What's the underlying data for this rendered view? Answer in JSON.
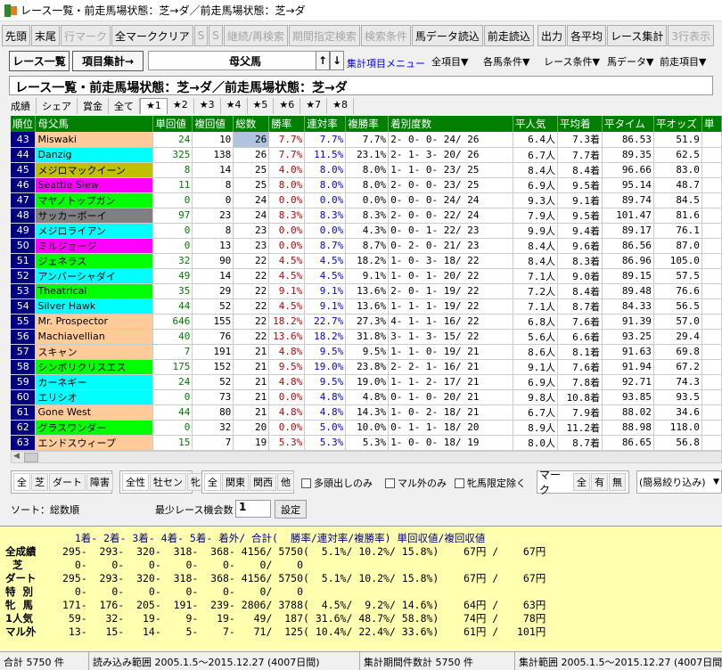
{
  "window": {
    "title": "レース一覧・前走馬場状態：芝→ダ／前走馬場状態：芝→ダ",
    "icon": "app-icon"
  },
  "toolbar": [
    {
      "label": "先頭",
      "enabled": true
    },
    {
      "label": "末尾",
      "enabled": true
    },
    {
      "label": "行マーク",
      "enabled": false
    },
    {
      "label": "全マーククリア",
      "enabled": true
    },
    {
      "label": "S",
      "enabled": false
    },
    {
      "label": "S",
      "enabled": false
    },
    {
      "label": "継続/再検索",
      "enabled": false
    },
    {
      "label": "期間指定検索",
      "enabled": false
    },
    {
      "label": "検索条件",
      "enabled": false
    },
    {
      "label": "馬データ読込",
      "enabled": true
    },
    {
      "label": "前走読込",
      "enabled": true
    },
    {
      "label": "出力",
      "enabled": true
    },
    {
      "label": "各平均",
      "enabled": true
    },
    {
      "label": "レース集計",
      "enabled": true
    },
    {
      "label": "3行表示",
      "enabled": false
    }
  ],
  "view": {
    "race_list": "レース一覧",
    "item_stats": "項目集計→",
    "combo_value": "母父馬",
    "up": "↑",
    "down": "↓",
    "menu_link": "集計項目メニュー"
  },
  "menus": [
    "全項目▼",
    "各馬条件▼",
    "レース条件▼",
    "馬データ▼",
    "前走項目▼"
  ],
  "condition_text": "レース一覧・前走馬場状態：芝→ダ／前走馬場状態：芝→ダ",
  "tabs": [
    "成績",
    "シェア",
    "賞金",
    "全て",
    "★1",
    "★2",
    "★3",
    "★4",
    "★5",
    "★6",
    "★7",
    "★8"
  ],
  "selected_tab": "★1",
  "table": {
    "headers": [
      "順位",
      "母父馬",
      "単回値",
      "複回値",
      "総数",
      "勝率",
      "連対率",
      "複勝率",
      "着別度数",
      "平人気",
      "平均着",
      "平タイム",
      "平オッズ",
      "単"
    ],
    "rows": [
      {
        "rank": "43",
        "name": "Miswaki",
        "color": "#ffcc99",
        "tan": "24",
        "fuku": "10",
        "n": "26",
        "w": "7.7%",
        "r": "7.7%",
        "f": "7.7%",
        "dist": "2-  0-  0- 24/ 26",
        "pop": "6.4人",
        "avg": "7.3着",
        "time": "86.53",
        "odds": "51.9"
      },
      {
        "rank": "44",
        "name": "Danzig",
        "color": "#00ffff",
        "tan": "325",
        "fuku": "138",
        "n": "26",
        "w": "7.7%",
        "r": "11.5%",
        "f": "23.1%",
        "dist": "2-  1-  3- 20/ 26",
        "pop": "6.7人",
        "avg": "7.7着",
        "time": "89.35",
        "odds": "62.5"
      },
      {
        "rank": "45",
        "name": "メジロマックイーン",
        "color": "#c0c000",
        "tan": "8",
        "fuku": "14",
        "n": "25",
        "w": "4.0%",
        "r": "8.0%",
        "f": "8.0%",
        "dist": "1-  1-  0- 23/ 25",
        "pop": "8.4人",
        "avg": "8.4着",
        "time": "96.66",
        "odds": "83.0"
      },
      {
        "rank": "46",
        "name": "Seattle Slew",
        "color": "#ff00ff",
        "tan": "11",
        "fuku": "8",
        "n": "25",
        "w": "8.0%",
        "r": "8.0%",
        "f": "8.0%",
        "dist": "2-  0-  0- 23/ 25",
        "pop": "6.9人",
        "avg": "9.5着",
        "time": "95.14",
        "odds": "48.7"
      },
      {
        "rank": "47",
        "name": "マヤノトップガン",
        "color": "#00ff00",
        "tan": "0",
        "fuku": "0",
        "n": "24",
        "w": "0.0%",
        "r": "0.0%",
        "f": "0.0%",
        "dist": "0-  0-  0- 24/ 24",
        "pop": "9.3人",
        "avg": "9.1着",
        "time": "89.74",
        "odds": "84.5"
      },
      {
        "rank": "48",
        "name": "サッカーボーイ",
        "color": "#808080",
        "tan": "97",
        "fuku": "23",
        "n": "24",
        "w": "8.3%",
        "r": "8.3%",
        "f": "8.3%",
        "dist": "2-  0-  0- 22/ 24",
        "pop": "7.9人",
        "avg": "9.5着",
        "time": "101.47",
        "odds": "81.6"
      },
      {
        "rank": "49",
        "name": "メジロライアン",
        "color": "#00ffff",
        "tan": "0",
        "fuku": "8",
        "n": "23",
        "w": "0.0%",
        "r": "0.0%",
        "f": "4.3%",
        "dist": "0-  0-  1- 22/ 23",
        "pop": "9.9人",
        "avg": "9.4着",
        "time": "89.17",
        "odds": "76.1"
      },
      {
        "rank": "50",
        "name": "ミルジョージ",
        "color": "#ff00ff",
        "tan": "0",
        "fuku": "13",
        "n": "23",
        "w": "0.0%",
        "r": "8.7%",
        "f": "8.7%",
        "dist": "0-  2-  0- 21/ 23",
        "pop": "8.4人",
        "avg": "9.6着",
        "time": "86.56",
        "odds": "87.0"
      },
      {
        "rank": "51",
        "name": "ジェネラス",
        "color": "#00ff00",
        "tan": "32",
        "fuku": "90",
        "n": "22",
        "w": "4.5%",
        "r": "4.5%",
        "f": "18.2%",
        "dist": "1-  0-  3- 18/ 22",
        "pop": "8.4人",
        "avg": "8.3着",
        "time": "86.96",
        "odds": "105.0"
      },
      {
        "rank": "52",
        "name": "アンバーシャダイ",
        "color": "#00ffff",
        "tan": "49",
        "fuku": "14",
        "n": "22",
        "w": "4.5%",
        "r": "4.5%",
        "f": "9.1%",
        "dist": "1-  0-  1- 20/ 22",
        "pop": "7.1人",
        "avg": "9.0着",
        "time": "89.15",
        "odds": "57.5"
      },
      {
        "rank": "53",
        "name": "Theatrical",
        "color": "#00ff00",
        "tan": "35",
        "fuku": "29",
        "n": "22",
        "w": "9.1%",
        "r": "9.1%",
        "f": "13.6%",
        "dist": "2-  0-  1- 19/ 22",
        "pop": "7.2人",
        "avg": "8.4着",
        "time": "89.48",
        "odds": "76.6"
      },
      {
        "rank": "54",
        "name": "Silver Hawk",
        "color": "#00ffff",
        "tan": "44",
        "fuku": "52",
        "n": "22",
        "w": "4.5%",
        "r": "9.1%",
        "f": "13.6%",
        "dist": "1-  1-  1- 19/ 22",
        "pop": "7.1人",
        "avg": "8.7着",
        "time": "84.33",
        "odds": "56.5"
      },
      {
        "rank": "55",
        "name": "Mr. Prospector",
        "color": "#ffcc99",
        "tan": "646",
        "fuku": "155",
        "n": "22",
        "w": "18.2%",
        "r": "22.7%",
        "f": "27.3%",
        "dist": "4-  1-  1- 16/ 22",
        "pop": "6.8人",
        "avg": "7.6着",
        "time": "91.39",
        "odds": "57.0"
      },
      {
        "rank": "56",
        "name": "Machiavellian",
        "color": "#ffcc99",
        "tan": "40",
        "fuku": "76",
        "n": "22",
        "w": "13.6%",
        "r": "18.2%",
        "f": "31.8%",
        "dist": "3-  1-  3- 15/ 22",
        "pop": "5.6人",
        "avg": "6.6着",
        "time": "93.25",
        "odds": "29.4"
      },
      {
        "rank": "57",
        "name": "スキャン",
        "color": "#ffcc99",
        "tan": "7",
        "fuku": "191",
        "n": "21",
        "w": "4.8%",
        "r": "9.5%",
        "f": "9.5%",
        "dist": "1-  1-  0- 19/ 21",
        "pop": "8.6人",
        "avg": "8.1着",
        "time": "91.63",
        "odds": "69.8"
      },
      {
        "rank": "58",
        "name": "シンボリクリスエス",
        "color": "#00ff00",
        "tan": "175",
        "fuku": "152",
        "n": "21",
        "w": "9.5%",
        "r": "19.0%",
        "f": "23.8%",
        "dist": "2-  2-  1- 16/ 21",
        "pop": "9.1人",
        "avg": "7.6着",
        "time": "91.94",
        "odds": "67.2"
      },
      {
        "rank": "59",
        "name": "カーネギー",
        "color": "#00ffff",
        "tan": "24",
        "fuku": "52",
        "n": "21",
        "w": "4.8%",
        "r": "9.5%",
        "f": "19.0%",
        "dist": "1-  1-  2- 17/ 21",
        "pop": "6.9人",
        "avg": "7.8着",
        "time": "92.71",
        "odds": "74.3"
      },
      {
        "rank": "60",
        "name": "エリシオ",
        "color": "#00ffff",
        "tan": "0",
        "fuku": "73",
        "n": "21",
        "w": "0.0%",
        "r": "4.8%",
        "f": "4.8%",
        "dist": "0-  1-  0- 20/ 21",
        "pop": "9.8人",
        "avg": "10.8着",
        "time": "93.85",
        "odds": "93.5"
      },
      {
        "rank": "61",
        "name": "Gone West",
        "color": "#ffcc99",
        "tan": "44",
        "fuku": "80",
        "n": "21",
        "w": "4.8%",
        "r": "4.8%",
        "f": "14.3%",
        "dist": "1-  0-  2- 18/ 21",
        "pop": "6.7人",
        "avg": "7.9着",
        "time": "88.02",
        "odds": "34.6"
      },
      {
        "rank": "62",
        "name": "グラスワンダー",
        "color": "#00ff00",
        "tan": "0",
        "fuku": "32",
        "n": "20",
        "w": "0.0%",
        "r": "5.0%",
        "f": "10.0%",
        "dist": "0-  1-  1- 18/ 20",
        "pop": "8.9人",
        "avg": "11.2着",
        "time": "88.98",
        "odds": "118.0"
      },
      {
        "rank": "63",
        "name": "エンドスウィープ",
        "color": "#ffcc99",
        "tan": "15",
        "fuku": "7",
        "n": "19",
        "w": "5.3%",
        "r": "5.3%",
        "f": "5.3%",
        "dist": "1-  0-  0- 18/ 19",
        "pop": "8.0人",
        "avg": "8.7着",
        "time": "86.65",
        "odds": "56.8"
      }
    ]
  },
  "filters": {
    "surface": [
      "全",
      "芝",
      "ダート",
      "障害"
    ],
    "sex": [
      "全性",
      "牡セン",
      "牝"
    ],
    "region": [
      "全",
      "関東",
      "関西",
      "他"
    ],
    "checks": [
      "多頭出しのみ",
      "マル外のみ",
      "牝馬限定除く"
    ],
    "mark_label": "マーク",
    "mark": [
      "全",
      "有",
      "無"
    ],
    "narrow": "(簡易絞り込み)"
  },
  "sort_label": "ソート：総数順",
  "min_races_label": "最少レース機会数",
  "min_races_value": "1",
  "set_button": "設定",
  "summary": {
    "header": "  1着- 2着- 3着- 4着- 5着- 着外/ 合計(  勝率/連対率/複勝率) 単回収値/複回収値",
    "rows": [
      {
        "label": "全成績",
        "text": "295-  293-  320-  318-  368- 4156/ 5750(  5.1%/ 10.2%/ 15.8%)    67円 /    67円"
      },
      {
        "label": "  芝  ",
        "text": "  0-    0-    0-    0-    0-    0/    0"
      },
      {
        "label": "ダート",
        "text": "295-  293-  320-  318-  368- 4156/ 5750(  5.1%/ 10.2%/ 15.8%)    67円 /    67円"
      },
      {
        "label": "特  別",
        "text": "  0-    0-    0-    0-    0-    0/    0"
      },
      {
        "label": "牝  馬",
        "text": "171-  176-  205-  191-  239- 2806/ 3788(  4.5%/  9.2%/ 14.6%)    64円 /    63円"
      },
      {
        "label": "1人気",
        "text": " 59-   32-   19-    9-   19-   49/  187( 31.6%/ 48.7%/ 58.8%)    74円 /    78円"
      },
      {
        "label": "マル外",
        "text": " 13-   15-   14-    5-    7-   71/  125( 10.4%/ 22.4%/ 33.6%)    61円 /   101円"
      }
    ]
  },
  "status": [
    "合計 5750 件",
    "読み込み範囲 2005.1.5〜2015.12.27 (4007日間)",
    "集計期間件数計 5750 件",
    "集計範囲 2005.1.5〜2015.12.27 (4007日間)"
  ]
}
